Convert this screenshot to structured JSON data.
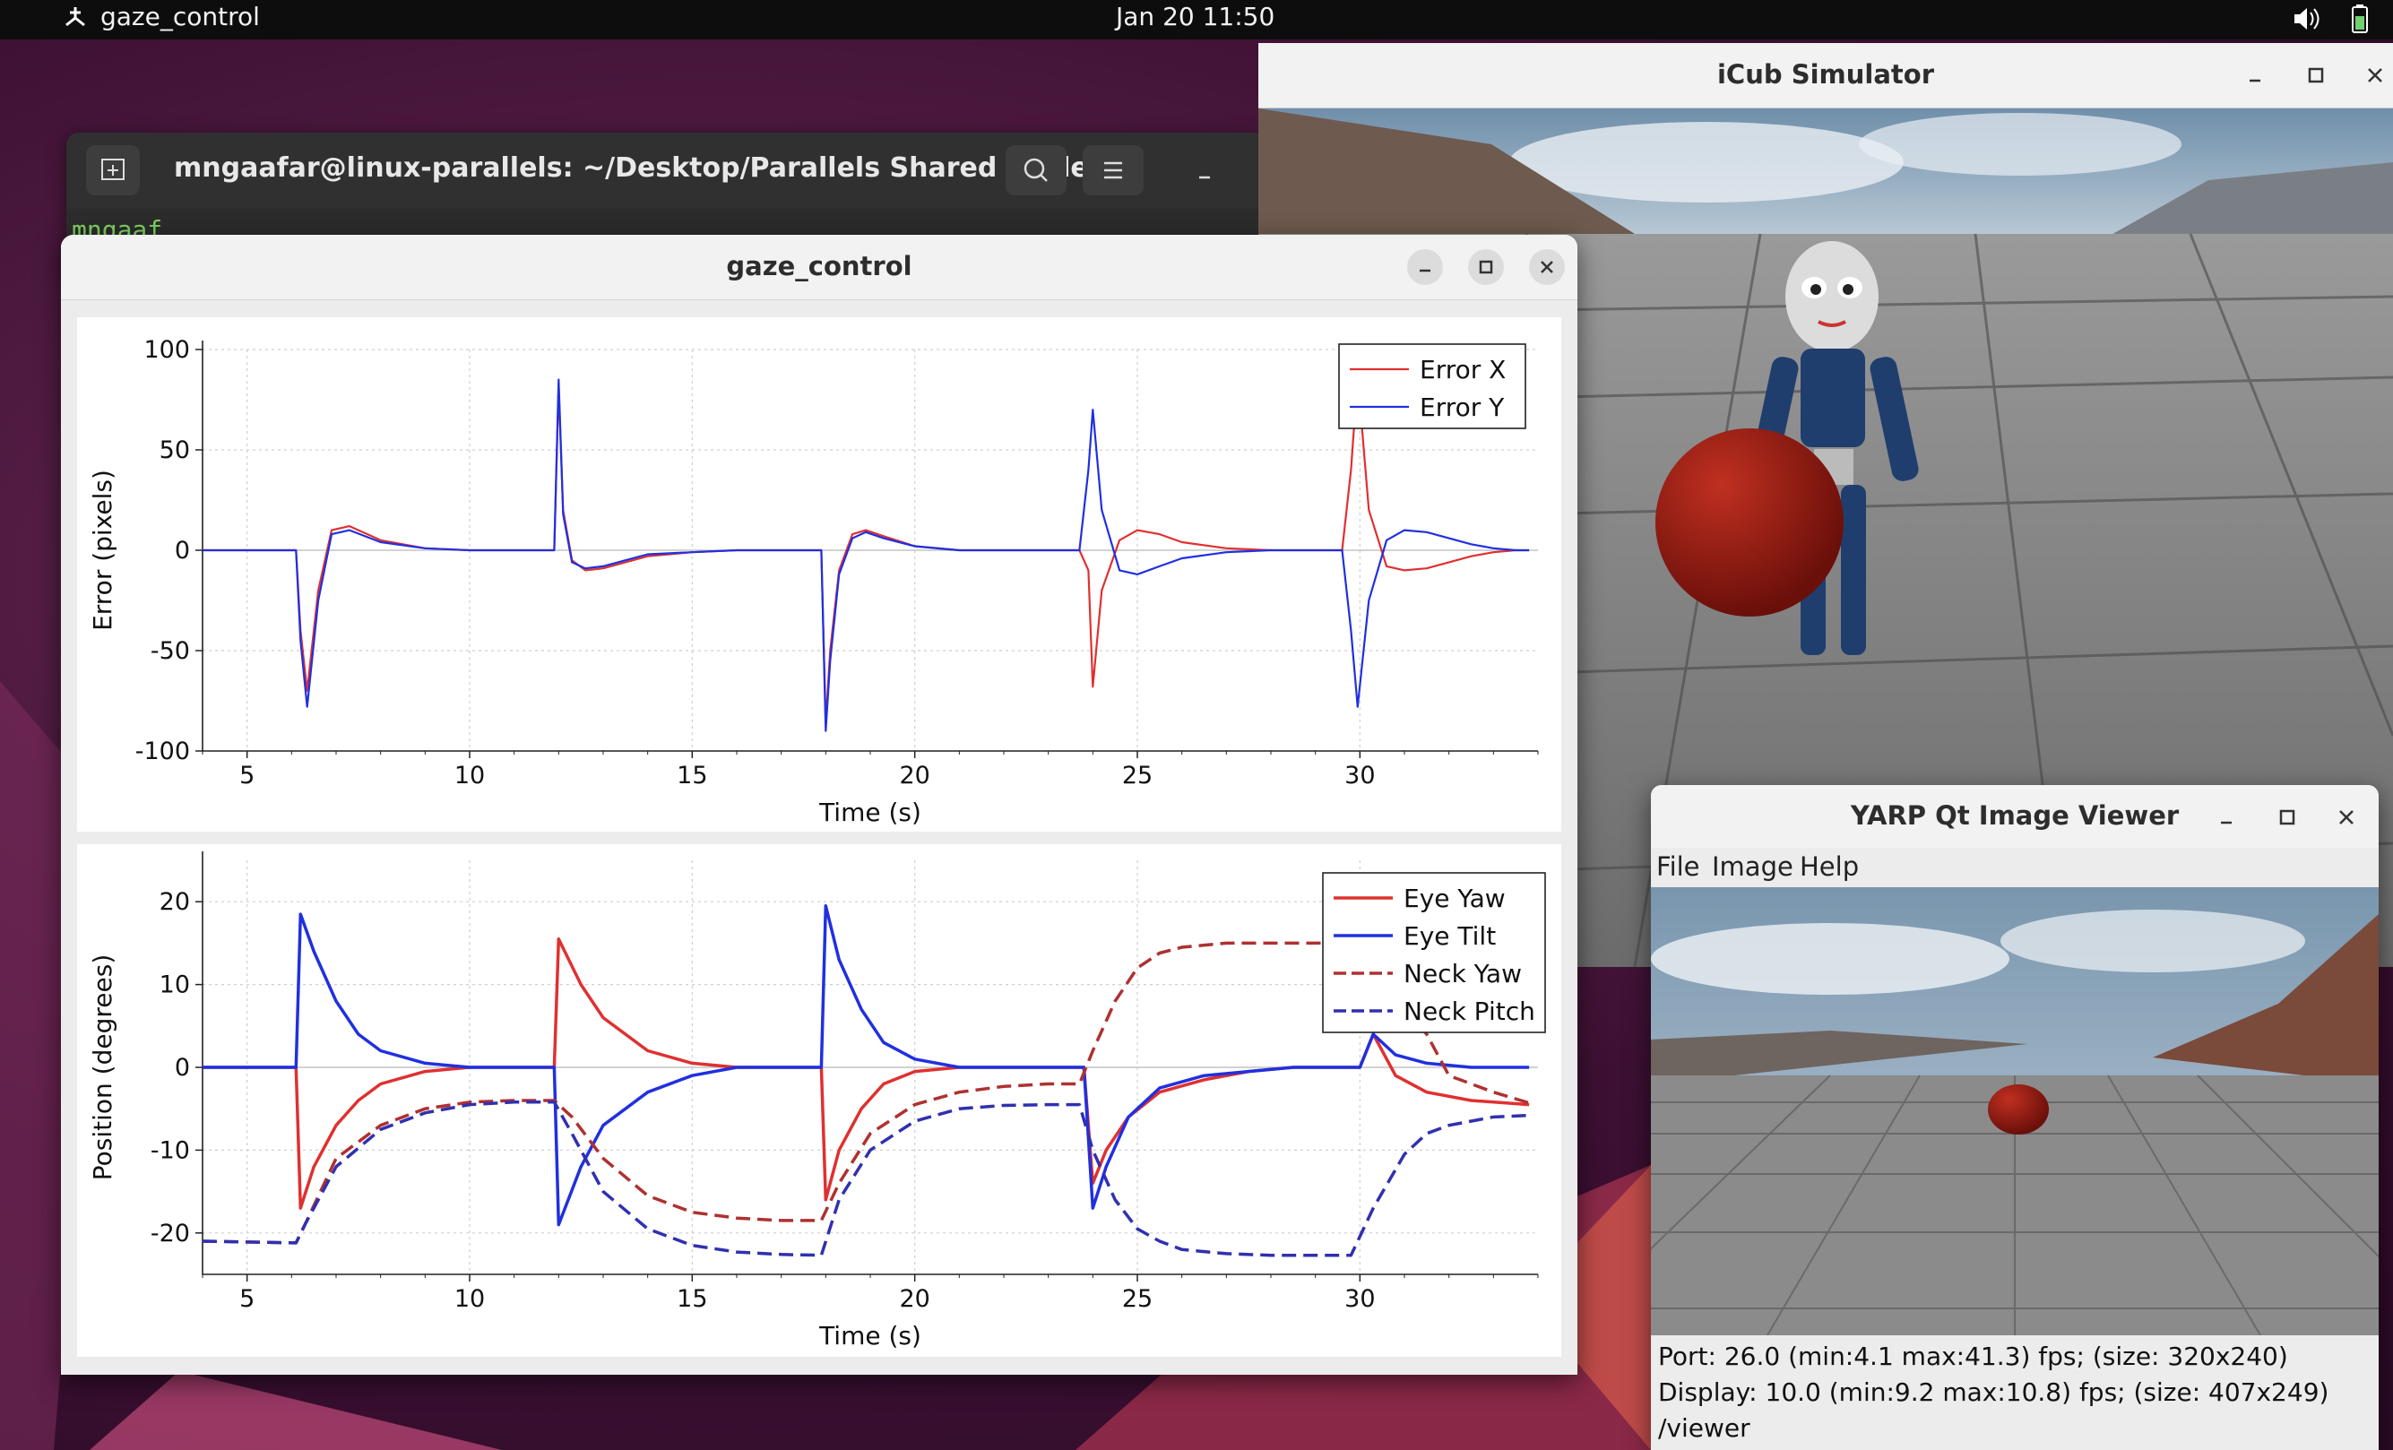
{
  "topbar": {
    "app_name": "gaze_control",
    "clock": "Jan 20  11:50",
    "icons": [
      "app-menu-icon",
      "volume-icon",
      "battery-icon"
    ]
  },
  "terminal": {
    "title": "mngaafar@linux-parallels: ~/Desktop/Parallels Shared Folde...",
    "prompt_fragment": "mngaaf",
    "icons": [
      "new-tab-icon",
      "search-icon",
      "menu-icon",
      "minimize-icon"
    ]
  },
  "gaze_window": {
    "title": "gaze_control",
    "icons": [
      "minimize-icon",
      "maximize-icon",
      "close-icon"
    ]
  },
  "icub_window": {
    "title": "iCub Simulator",
    "icons": [
      "minimize-icon",
      "maximize-icon",
      "close-icon"
    ]
  },
  "yarp_window": {
    "title": "YARP Qt Image Viewer",
    "menu": [
      "File",
      "Image",
      "Help"
    ],
    "status": {
      "port": "Port: 26.0 (min:4.1 max:41.3) fps; (size: 320x240)",
      "display": "Display: 10.0 (min:9.2 max:10.8) fps; (size: 407x249)",
      "name": "/viewer"
    }
  },
  "chart_data": [
    {
      "type": "line",
      "xlabel": "Time (s)",
      "ylabel": "Error (pixels)",
      "xlim": [
        4,
        34
      ],
      "ylim": [
        -100,
        100
      ],
      "xticks": [
        5,
        10,
        15,
        20,
        25,
        30
      ],
      "yticks": [
        -100,
        -50,
        0,
        50,
        100
      ],
      "grid": true,
      "legend": "top-right",
      "colors": {
        "Error X": "#e03030",
        "Error Y": "#2030e0"
      },
      "series": [
        {
          "name": "Error X",
          "x": [
            4,
            6.1,
            6.2,
            6.35,
            6.6,
            6.9,
            7.3,
            8,
            9,
            10,
            11,
            11.9,
            12,
            12.1,
            12.3,
            12.6,
            13,
            13.5,
            14,
            15,
            16,
            17,
            17.9,
            18,
            18.1,
            18.3,
            18.6,
            18.9,
            19.3,
            20,
            21,
            22,
            23,
            23.7,
            23.9,
            24.0,
            24.2,
            24.6,
            25,
            25.5,
            26,
            27,
            28,
            29,
            29.6,
            29.8,
            29.95,
            30.2,
            30.6,
            31,
            31.5,
            32,
            32.5,
            33,
            33.5,
            33.8
          ],
          "y": [
            0,
            0,
            -40,
            -70,
            -20,
            10,
            12,
            5,
            1,
            0,
            0,
            0,
            82,
            20,
            -5,
            -10,
            -9,
            -6,
            -3,
            -1,
            0,
            0,
            0,
            -86,
            -50,
            -10,
            8,
            10,
            7,
            2,
            0,
            0,
            0,
            0,
            -10,
            -68,
            -20,
            5,
            10,
            8,
            4,
            1,
            0,
            0,
            0,
            40,
            87,
            20,
            -8,
            -10,
            -9,
            -6,
            -3,
            -1,
            0,
            0
          ]
        },
        {
          "name": "Error Y",
          "x": [
            4,
            6.1,
            6.2,
            6.35,
            6.6,
            6.9,
            7.3,
            8,
            9,
            10,
            11,
            11.9,
            12,
            12.1,
            12.3,
            12.6,
            13,
            13.5,
            14,
            15,
            16,
            17,
            17.9,
            18,
            18.1,
            18.3,
            18.6,
            18.9,
            19.3,
            20,
            21,
            22,
            23,
            23.7,
            23.9,
            24.0,
            24.2,
            24.6,
            25,
            25.5,
            26,
            27,
            28,
            29,
            29.6,
            29.8,
            29.95,
            30.2,
            30.6,
            31,
            31.5,
            32,
            32.5,
            33,
            33.5,
            33.8
          ],
          "y": [
            0,
            0,
            -45,
            -78,
            -25,
            8,
            10,
            4,
            1,
            0,
            0,
            0,
            85,
            18,
            -6,
            -9,
            -8,
            -5,
            -2,
            -1,
            0,
            0,
            0,
            -90,
            -55,
            -12,
            6,
            9,
            6,
            2,
            0,
            0,
            0,
            0,
            40,
            70,
            20,
            -10,
            -12,
            -8,
            -4,
            -1,
            0,
            0,
            0,
            -40,
            -78,
            -25,
            5,
            10,
            9,
            6,
            3,
            1,
            0,
            0
          ]
        }
      ]
    },
    {
      "type": "line",
      "xlabel": "Time (s)",
      "ylabel": "Position (degrees)",
      "xlim": [
        4,
        34
      ],
      "ylim": [
        -25,
        25
      ],
      "xticks": [
        5,
        10,
        15,
        20,
        25,
        30
      ],
      "yticks": [
        -20,
        -10,
        0,
        10,
        20
      ],
      "grid": true,
      "legend": "top-right",
      "colors": {
        "Eye Yaw": "#e03030",
        "Eye Tilt": "#2030e0",
        "Neck Yaw": "#b03030",
        "Neck Pitch": "#3030b0"
      },
      "series": [
        {
          "name": "Eye Yaw",
          "x": [
            4,
            6.1,
            6.2,
            6.5,
            7,
            7.5,
            8,
            9,
            10,
            11,
            11.8,
            11.9,
            12,
            12.5,
            13,
            14,
            15,
            16,
            17,
            17.9,
            18,
            18.3,
            18.8,
            19.3,
            20,
            21,
            22,
            23,
            23.7,
            23.8,
            24,
            24.3,
            24.8,
            25.5,
            26.5,
            27.5,
            28.5,
            29.5,
            29.8,
            30,
            30.3,
            30.8,
            31.5,
            32.5,
            33.8
          ],
          "y": [
            0,
            0,
            -17,
            -12,
            -7,
            -4,
            -2,
            -0.5,
            0,
            0,
            0,
            0,
            15.5,
            10,
            6,
            2,
            0.5,
            0,
            0,
            0,
            -16,
            -10,
            -5,
            -2,
            -0.5,
            0,
            0,
            0,
            0,
            0,
            -14,
            -10,
            -6,
            -3,
            -1.5,
            -0.5,
            0,
            0,
            0,
            0,
            4,
            -1,
            -3,
            -4,
            -4.5
          ]
        },
        {
          "name": "Eye Tilt",
          "x": [
            4,
            6.1,
            6.2,
            6.5,
            7,
            7.5,
            8,
            9,
            10,
            11,
            11.8,
            11.9,
            12,
            12.5,
            13,
            14,
            15,
            16,
            17,
            17.9,
            18,
            18.3,
            18.8,
            19.3,
            20,
            21,
            22,
            23,
            23.7,
            23.8,
            24,
            24.3,
            24.8,
            25.5,
            26.5,
            27.5,
            28.5,
            29.5,
            29.8,
            30,
            30.3,
            30.8,
            31.5,
            32.5,
            33.8
          ],
          "y": [
            0,
            0,
            18.5,
            14,
            8,
            4,
            2,
            0.5,
            0,
            0,
            0,
            0,
            -19,
            -12,
            -7,
            -3,
            -1,
            0,
            0,
            0,
            19.5,
            13,
            7,
            3,
            1,
            0,
            0,
            0,
            0,
            0,
            -17,
            -12,
            -6,
            -2.5,
            -1,
            -0.5,
            0,
            0,
            0,
            0,
            4,
            1.5,
            0.5,
            0,
            0
          ]
        },
        {
          "name": "Neck Yaw",
          "x": [
            4,
            6.1,
            6.3,
            7,
            8,
            9,
            10,
            11,
            11.9,
            12.3,
            13,
            14,
            15,
            16,
            17,
            17.9,
            18.3,
            19,
            20,
            21,
            22,
            23,
            23.7,
            24,
            24.5,
            25,
            25.5,
            26,
            27,
            28,
            29,
            29.8,
            30.3,
            31,
            31.5,
            32,
            33,
            33.8
          ],
          "y": [
            -21,
            -21.2,
            -19,
            -11,
            -7,
            -5,
            -4.2,
            -4,
            -4,
            -6,
            -11,
            -15.5,
            -17.5,
            -18.2,
            -18.5,
            -18.5,
            -14,
            -8,
            -4.5,
            -3,
            -2.3,
            -2,
            -2,
            2,
            8,
            12,
            13.8,
            14.5,
            15,
            15,
            15,
            15,
            12,
            7,
            4,
            -1,
            -3,
            -4.3
          ]
        },
        {
          "name": "Neck Pitch",
          "x": [
            4,
            6.1,
            6.3,
            7,
            8,
            9,
            10,
            11,
            11.9,
            12.3,
            13,
            14,
            15,
            16,
            17,
            17.9,
            18.3,
            19,
            20,
            21,
            22,
            23,
            23.7,
            24,
            24.5,
            25,
            25.5,
            26,
            27,
            28,
            29,
            29.8,
            30.3,
            31,
            31.5,
            32,
            33,
            33.8
          ],
          "y": [
            -21,
            -21.2,
            -19,
            -12,
            -7.5,
            -5.5,
            -4.5,
            -4.2,
            -4.2,
            -8,
            -15,
            -19.5,
            -21.5,
            -22.3,
            -22.6,
            -22.7,
            -16,
            -10,
            -6.5,
            -5,
            -4.6,
            -4.5,
            -4.5,
            -10,
            -16,
            -19.5,
            -21,
            -22,
            -22.5,
            -22.7,
            -22.7,
            -22.7,
            -17,
            -10.5,
            -8,
            -7,
            -6,
            -5.8
          ]
        }
      ]
    }
  ]
}
